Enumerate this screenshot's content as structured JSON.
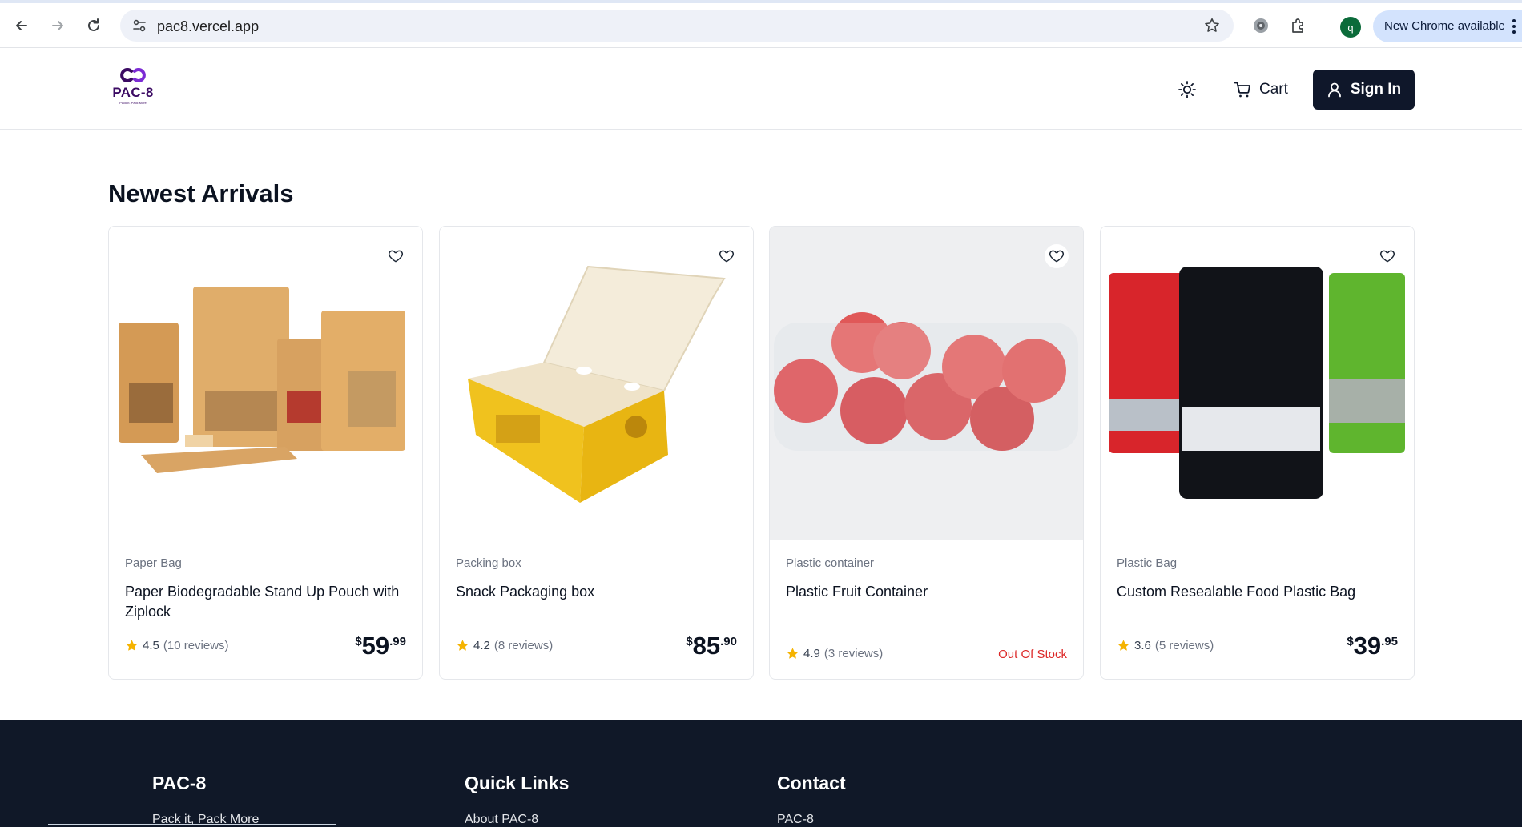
{
  "browser": {
    "url": "pac8.vercel.app",
    "profile_initial": "q",
    "update_label": "New Chrome available"
  },
  "header": {
    "logo_text": "PAC-8",
    "logo_tagline": "Pack It. Pack More",
    "cart_label": "Cart",
    "signin_label": "Sign In"
  },
  "main": {
    "section_title": "Newest Arrivals",
    "products": [
      {
        "category": "Paper Bag",
        "title": "Paper Biodegradable Stand Up Pouch with Ziplock",
        "rating": "4.5",
        "reviews": "(10 reviews)",
        "price_currency": "$",
        "price_whole": "59",
        "price_cents": ".99"
      },
      {
        "category": "Packing box",
        "title": "Snack Packaging box",
        "rating": "4.2",
        "reviews": "(8 reviews)",
        "price_currency": "$",
        "price_whole": "85",
        "price_cents": ".90"
      },
      {
        "category": "Plastic container",
        "title": "Plastic Fruit Container",
        "rating": "4.9",
        "reviews": "(3 reviews)",
        "stock_status": "Out Of Stock"
      },
      {
        "category": "Plastic Bag",
        "title": "Custom Resealable Food Plastic Bag",
        "rating": "3.6",
        "reviews": "(5 reviews)",
        "price_currency": "$",
        "price_whole": "39",
        "price_cents": ".95"
      }
    ]
  },
  "footer": {
    "brand_heading": "PAC-8",
    "brand_tagline": "Pack it, Pack More",
    "links_heading": "Quick Links",
    "links_first": "About PAC-8",
    "contact_heading": "Contact",
    "contact_first": "PAC-8"
  },
  "colors": {
    "header_button_bg": "#0f172a",
    "footer_bg": "#101828",
    "star": "#f5b301",
    "out_of_stock": "#dc2626",
    "logo": "#3b0a63"
  }
}
